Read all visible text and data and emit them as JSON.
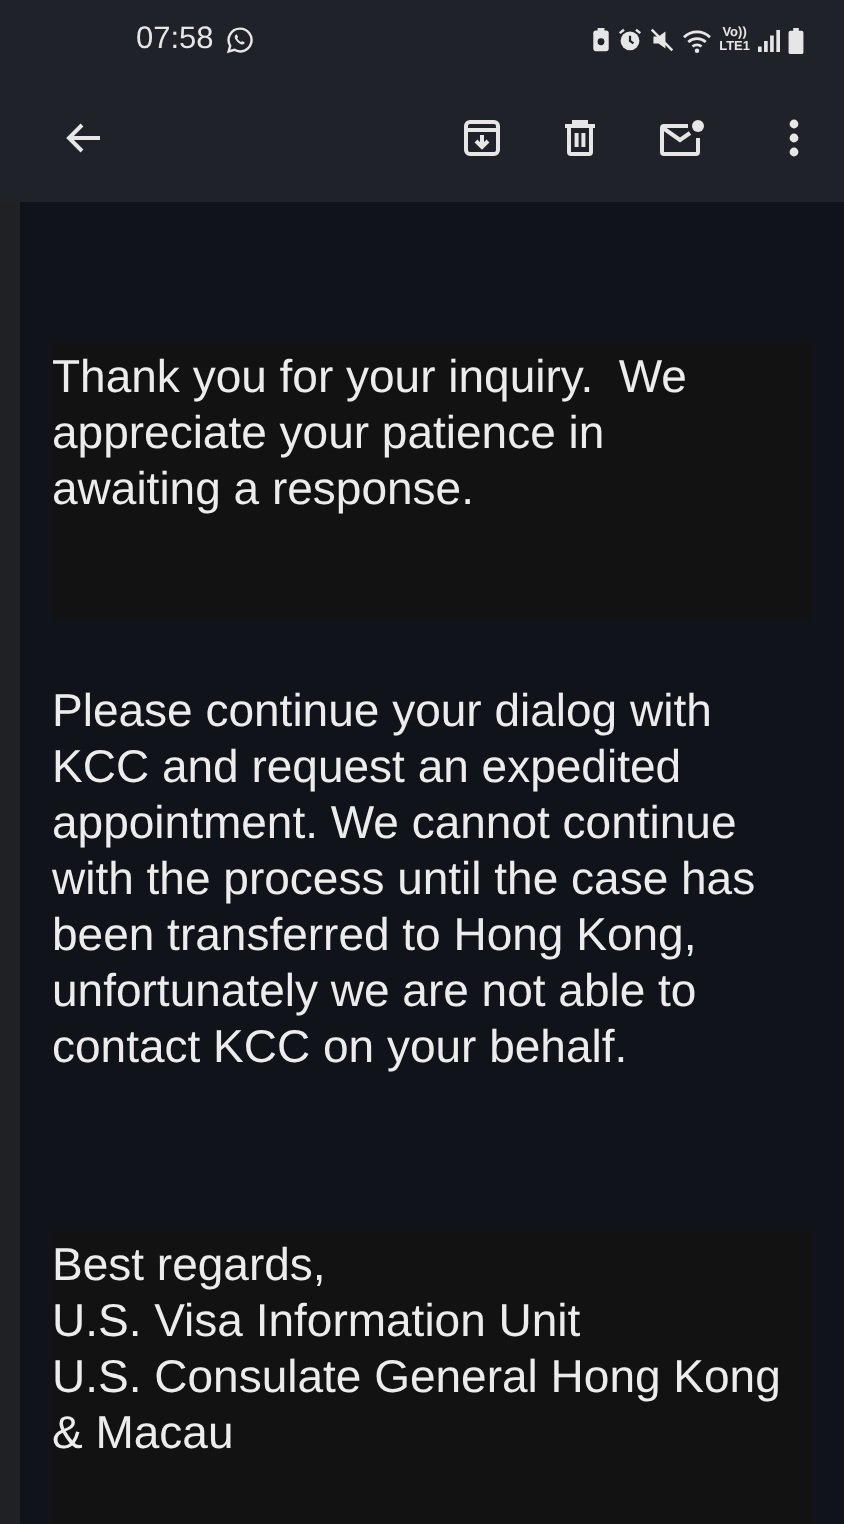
{
  "status_bar": {
    "time": "07:58",
    "network_label": "Vo))\nLTE1"
  },
  "toolbar": {
    "actions": [
      {
        "kind": "archive"
      },
      {
        "kind": "delete"
      },
      {
        "kind": "unread"
      },
      {
        "kind": "more"
      }
    ]
  },
  "message": {
    "paragraphs": [
      {
        "boxed": true,
        "lines": [
          "Thank you for your inquiry.  We",
          "appreciate your patience in",
          "awaiting a response."
        ]
      },
      {
        "boxed": false,
        "lines": [
          "Please continue your dialog with",
          "KCC and request an expedited",
          "appointment. We cannot continue",
          "with the process until the case has",
          "been transferred to Hong Kong,",
          "unfortunately we are not able to",
          "contact KCC on your behalf."
        ]
      },
      {
        "boxed": true,
        "lines": [
          "Best regards,",
          "U.S. Visa Information Unit",
          "U.S. Consulate General Hong Kong",
          "& Macau"
        ]
      }
    ]
  }
}
